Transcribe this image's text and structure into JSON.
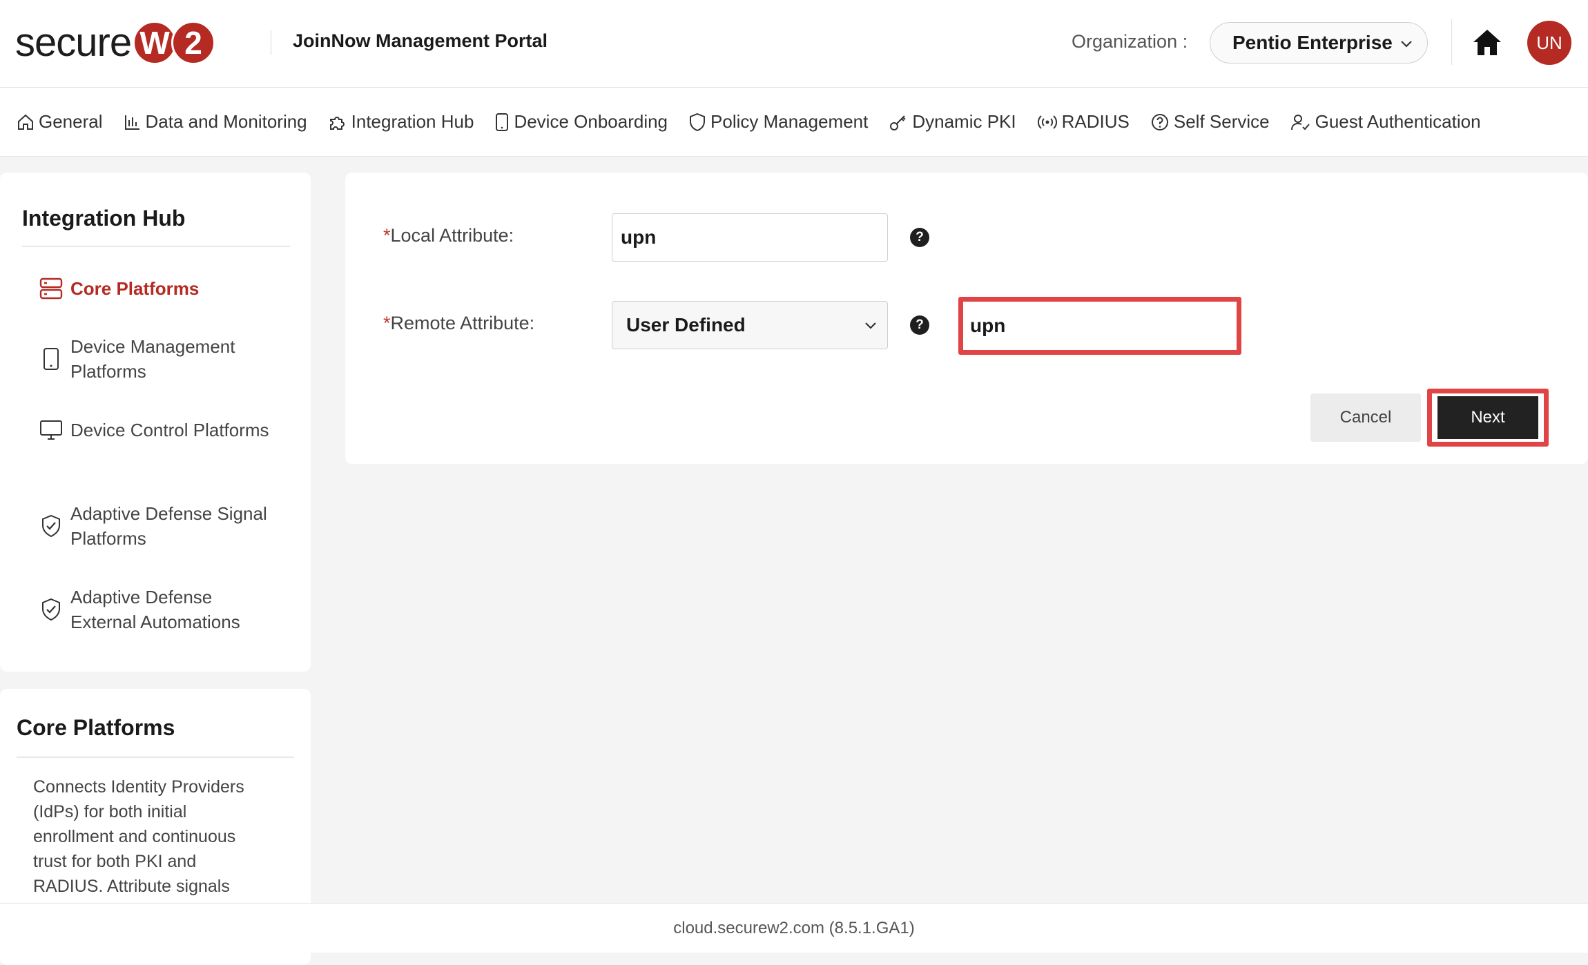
{
  "header": {
    "logo_text": "secure",
    "logo_badge_1": "W",
    "logo_badge_2": "2",
    "portal_title": "JoinNow Management Portal",
    "org_label": "Organization :",
    "org_value": "Pentio Enterprise",
    "avatar_initials": "UN",
    "brand_color": "#b52a23"
  },
  "nav": {
    "items": [
      {
        "label": "General",
        "icon": "home-outline-icon"
      },
      {
        "label": "Data and Monitoring",
        "icon": "bar-chart-icon"
      },
      {
        "label": "Integration Hub",
        "icon": "puzzle-icon"
      },
      {
        "label": "Device Onboarding",
        "icon": "phone-icon"
      },
      {
        "label": "Policy Management",
        "icon": "shield-icon"
      },
      {
        "label": "Dynamic PKI",
        "icon": "key-icon"
      },
      {
        "label": "RADIUS",
        "icon": "broadcast-icon"
      },
      {
        "label": "Self Service",
        "icon": "question-circle-icon"
      },
      {
        "label": "Guest Authentication",
        "icon": "user-check-icon"
      }
    ]
  },
  "sidebar": {
    "title": "Integration Hub",
    "items": [
      {
        "label": "Core Platforms",
        "icon": "server-icon",
        "active": true
      },
      {
        "label": "Device Management Platforms",
        "icon": "phone-icon"
      },
      {
        "label": "Device Control Platforms",
        "icon": "monitor-icon"
      },
      {
        "label": "Adaptive Defense Signal Platforms",
        "icon": "shield-check-icon"
      },
      {
        "label": "Adaptive Defense External Automations",
        "icon": "shield-check-icon"
      }
    ]
  },
  "info": {
    "title": "Core Platforms",
    "text": "Connects Identity Providers (IdPs) for both initial enrollment and continuous trust for both PKI and RADIUS. Attribute signals"
  },
  "form": {
    "local_attribute": {
      "required_mark": "*",
      "label": "Local Attribute:",
      "value": "upn",
      "help": "?"
    },
    "remote_attribute": {
      "required_mark": "*",
      "label": "Remote Attribute:",
      "select_value": "User Defined",
      "custom_value": "upn",
      "help": "?"
    },
    "cancel_label": "Cancel",
    "next_label": "Next",
    "highlight_color": "#e04444"
  },
  "footer": {
    "text": "cloud.securew2.com (8.5.1.GA1)"
  }
}
